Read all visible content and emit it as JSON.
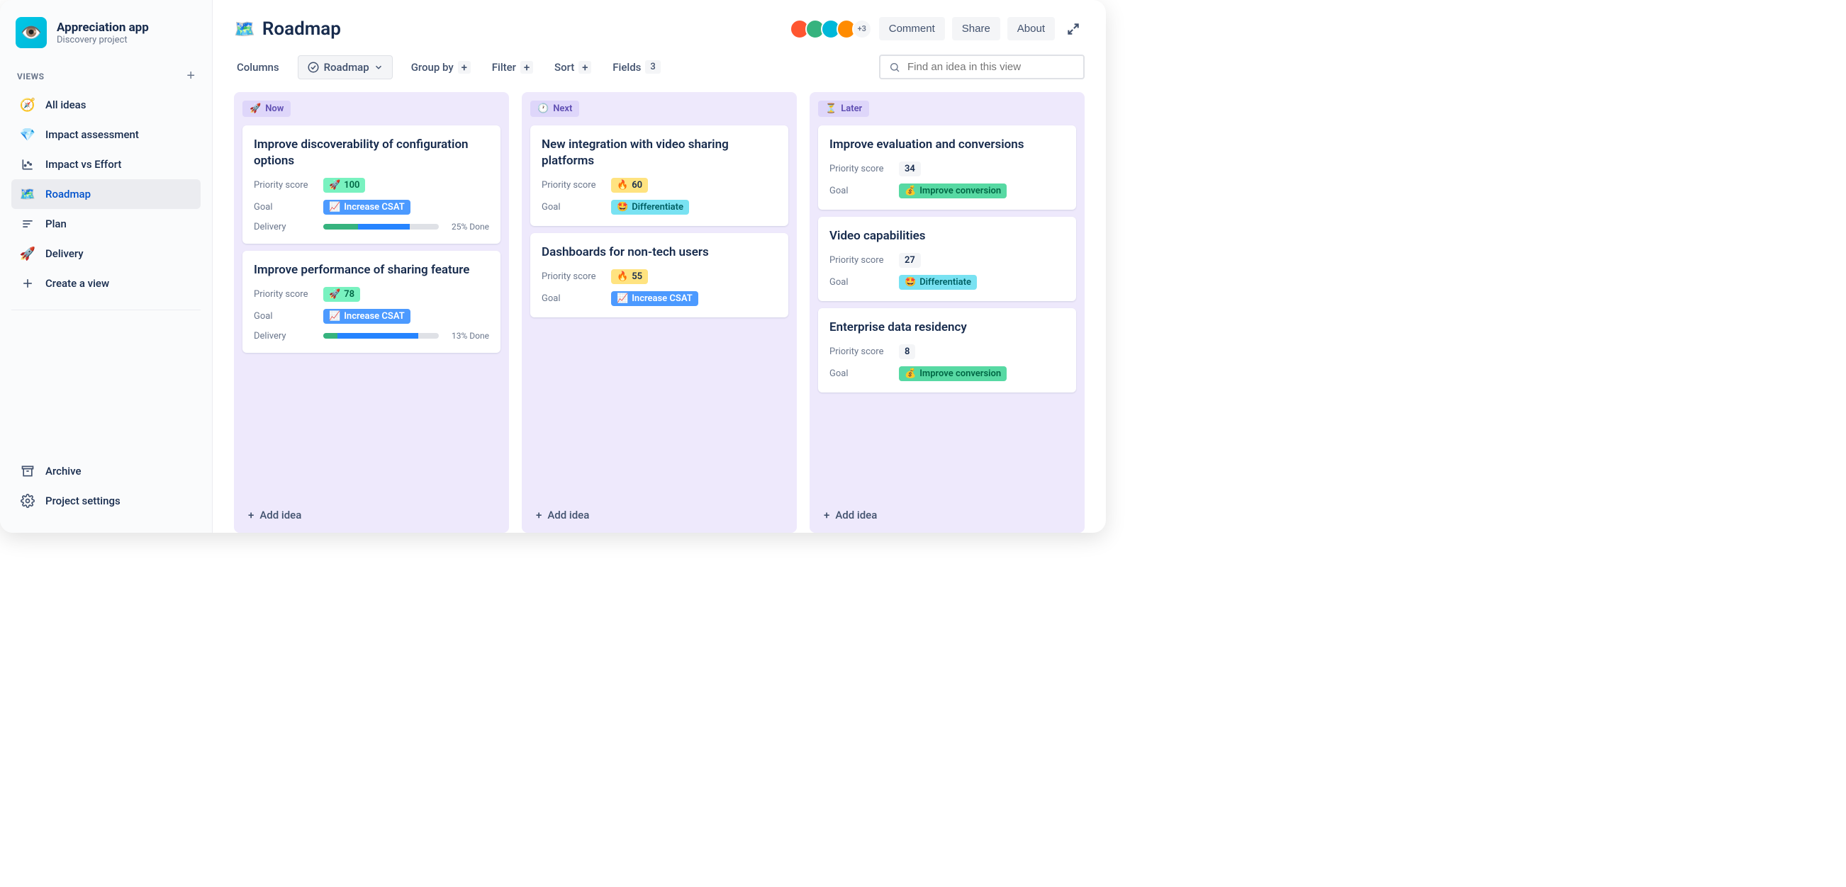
{
  "sidebar": {
    "brand_title": "Appreciation app",
    "brand_subtitle": "Discovery project",
    "views_label": "VIEWS",
    "items": [
      {
        "label": "All ideas",
        "icon": "🧭"
      },
      {
        "label": "Impact assessment",
        "icon": "💎"
      },
      {
        "label": "Impact vs Effort",
        "icon": "📊"
      },
      {
        "label": "Roadmap",
        "icon": "🗺️",
        "active": true
      },
      {
        "label": "Plan",
        "icon": "≡"
      },
      {
        "label": "Delivery",
        "icon": "🚀"
      },
      {
        "label": "Create a view",
        "icon": "+"
      }
    ],
    "bottom": [
      {
        "label": "Archive",
        "icon": "archive"
      },
      {
        "label": "Project settings",
        "icon": "gear"
      }
    ]
  },
  "header": {
    "title": "Roadmap",
    "title_icon": "🗺️",
    "avatar_overflow": "+3",
    "comment": "Comment",
    "share": "Share",
    "about": "About"
  },
  "toolbar": {
    "columns": "Columns",
    "roadmap_filter": "Roadmap",
    "group_by": "Group by",
    "filter": "Filter",
    "sort": "Sort",
    "fields": "Fields",
    "fields_count": "3",
    "search_placeholder": "Find an idea in this view"
  },
  "board": {
    "add_idea_label": "Add idea",
    "labels": {
      "priority": "Priority score",
      "goal": "Goal",
      "delivery": "Delivery"
    },
    "columns": [
      {
        "name": "Now",
        "icon": "🚀",
        "cards": [
          {
            "title": "Improve discoverability of configuration options",
            "priority": {
              "value": "100",
              "icon": "🚀",
              "style": "green"
            },
            "goal": {
              "label": "Increase CSAT",
              "icon": "📈",
              "style": "blue"
            },
            "delivery": {
              "done_pct": 25,
              "green_pct": 30,
              "blue_pct": 45,
              "text": "25% Done"
            }
          },
          {
            "title": "Improve performance of sharing feature",
            "priority": {
              "value": "78",
              "icon": "🚀",
              "style": "green"
            },
            "goal": {
              "label": "Increase CSAT",
              "icon": "📈",
              "style": "blue"
            },
            "delivery": {
              "done_pct": 13,
              "green_pct": 12,
              "blue_pct": 70,
              "text": "13% Done"
            }
          }
        ]
      },
      {
        "name": "Next",
        "icon": "🕐",
        "cards": [
          {
            "title": "New integration with video sharing platforms",
            "priority": {
              "value": "60",
              "icon": "🔥",
              "style": "yellow"
            },
            "goal": {
              "label": "Differentiate",
              "icon": "🤩",
              "style": "teal"
            }
          },
          {
            "title": "Dashboards for non-tech users",
            "priority": {
              "value": "55",
              "icon": "🔥",
              "style": "yellow"
            },
            "goal": {
              "label": "Increase CSAT",
              "icon": "📈",
              "style": "blue"
            }
          }
        ]
      },
      {
        "name": "Later",
        "icon": "⏳",
        "cards": [
          {
            "title": "Improve evaluation and conversions",
            "priority": {
              "value": "34",
              "style": "plain"
            },
            "goal": {
              "label": "Improve conversion",
              "icon": "💰",
              "style": "mint"
            }
          },
          {
            "title": "Video capabilities",
            "priority": {
              "value": "27",
              "style": "plain"
            },
            "goal": {
              "label": "Differentiate",
              "icon": "🤩",
              "style": "teal"
            }
          },
          {
            "title": "Enterprise data residency",
            "priority": {
              "value": "8",
              "style": "plain"
            },
            "goal": {
              "label": "Improve conversion",
              "icon": "💰",
              "style": "mint"
            }
          }
        ]
      }
    ]
  }
}
